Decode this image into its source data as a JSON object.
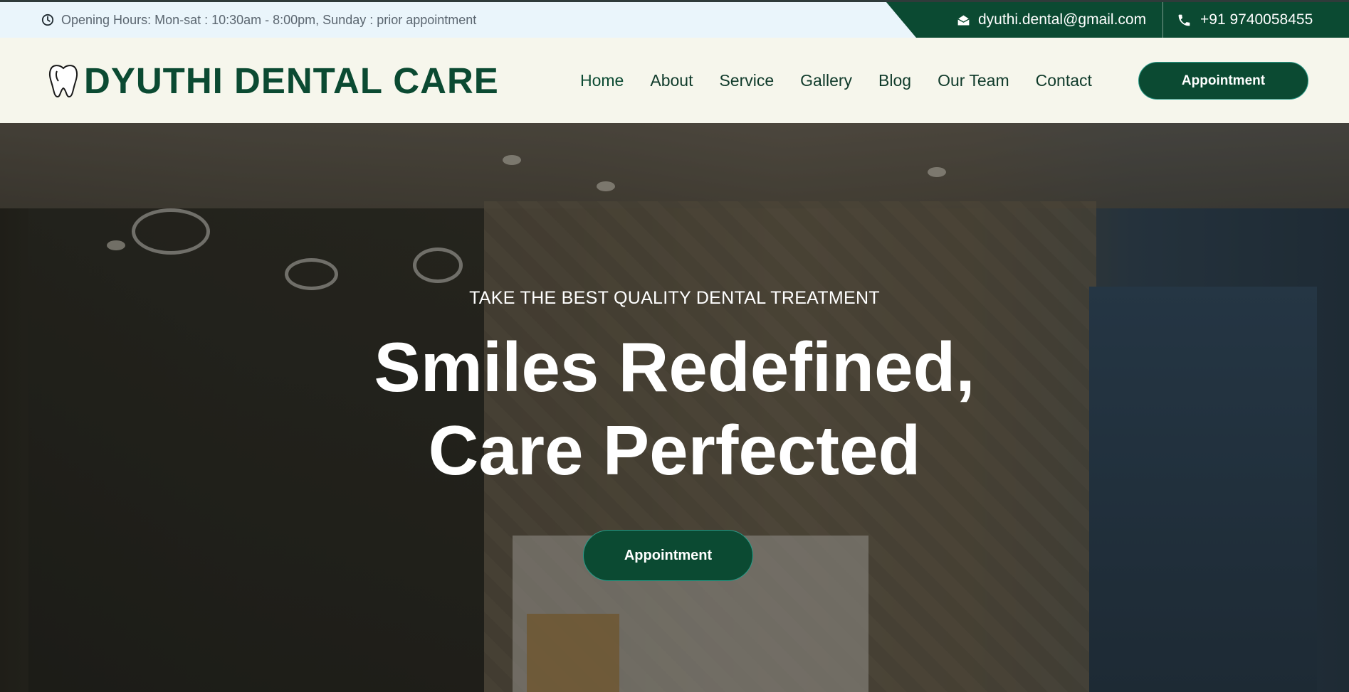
{
  "topbar": {
    "hours_icon": "clock-icon",
    "hours_text": "Opening Hours: Mon-sat : 10:30am - 8:00pm, Sunday : prior appointment",
    "email_icon": "envelope-open-icon",
    "email": "dyuthi.dental@gmail.com",
    "phone_icon": "phone-icon",
    "phone": "+91 9740058455"
  },
  "header": {
    "logo_icon": "tooth-icon",
    "logo_text": "DYUTHI DENTAL CARE",
    "nav": [
      "Home",
      "About",
      "Service",
      "Gallery",
      "Blog",
      "Our Team",
      "Contact"
    ],
    "active_nav": "Home",
    "appointment_label": "Appointment"
  },
  "hero": {
    "subtitle": "TAKE THE BEST QUALITY DENTAL TREATMENT",
    "title_line1": "Smiles Redefined,",
    "title_line2": "Care Perfected",
    "button_label": "Appointment"
  },
  "colors": {
    "brand_green": "#0b4a32",
    "topbar_bg": "#eaf5fb",
    "header_bg": "#f6f6ec",
    "button_border": "#2a9a88"
  }
}
